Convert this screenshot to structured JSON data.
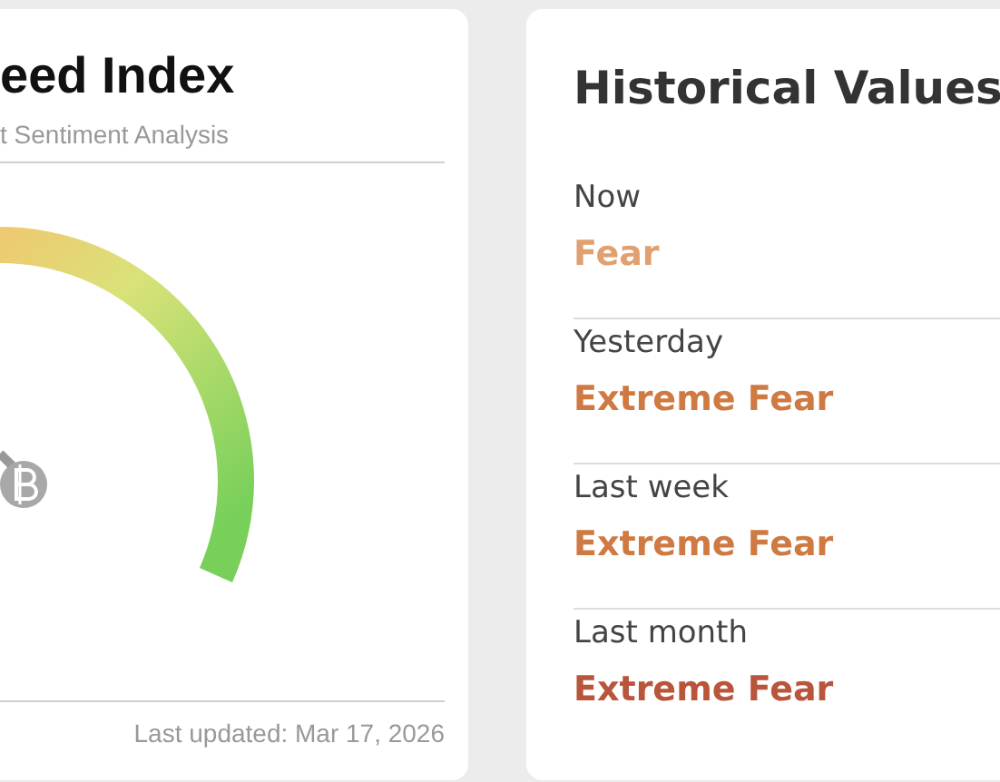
{
  "index_card": {
    "title": "eed Index",
    "subtitle": "t Sentiment Analysis",
    "last_updated": "Last updated: Mar 17, 2026"
  },
  "history_card": {
    "title": "Historical Values",
    "rows": [
      {
        "label": "Now",
        "value": "Fear",
        "color": "#e0a070"
      },
      {
        "label": "Yesterday",
        "value": "Extreme Fear",
        "color": "#cf7a42"
      },
      {
        "label": "Last week",
        "value": "Extreme Fear",
        "color": "#cf7a42"
      },
      {
        "label": "Last month",
        "value": "Extreme Fear",
        "color": "#b9553a"
      }
    ]
  }
}
